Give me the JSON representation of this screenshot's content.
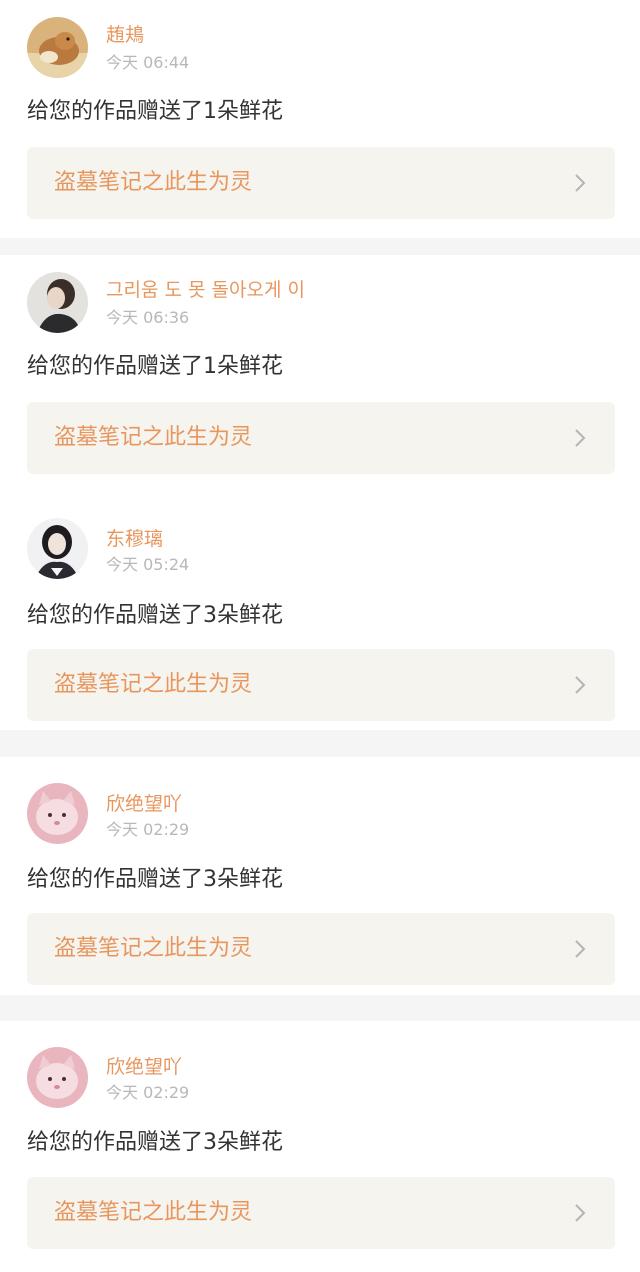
{
  "colors": {
    "accent": "#e8965e",
    "meta": "#b8b8b8",
    "body_text": "#333333",
    "link_bg": "#f5f4ef",
    "page_bg": "#f6f5f5"
  },
  "notifications": [
    {
      "username": "䞥鳺",
      "time": "今天 06:44",
      "message": "给您的作品赠送了1朵鲜花",
      "work_title": "盗墓笔记之此生为灵",
      "avatar": "cat-photo-avatar"
    },
    {
      "username": "그리움 도 못 돌아오게 이",
      "time": "今天 06:36",
      "message": "给您的作品赠送了1朵鲜花",
      "work_title": "盗墓笔记之此生为灵",
      "avatar": "person-photo-avatar"
    },
    {
      "username": "东穆璃",
      "time": "今天 05:24",
      "message": "给您的作品赠送了3朵鲜花",
      "work_title": "盗墓笔记之此生为灵",
      "avatar": "girl-photo-avatar"
    },
    {
      "username": "欣绝望吖",
      "time": "今天 02:29",
      "message": "给您的作品赠送了3朵鲜花",
      "work_title": "盗墓笔记之此生为灵",
      "avatar": "pink-cat-avatar"
    },
    {
      "username": "欣绝望吖",
      "time": "今天 02:29",
      "message": "给您的作品赠送了3朵鲜花",
      "work_title": "盗墓笔记之此生为灵",
      "avatar": "pink-cat-avatar"
    }
  ]
}
